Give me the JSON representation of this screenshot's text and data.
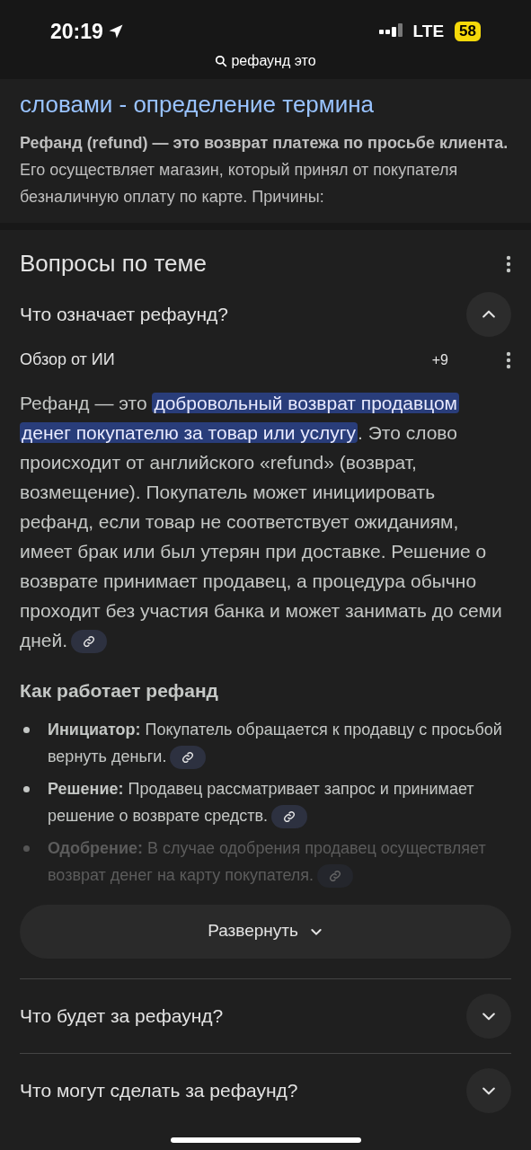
{
  "status_bar": {
    "time": "20:19",
    "network": "LTE",
    "battery": "58"
  },
  "address_bar": {
    "query": "рефаунд это"
  },
  "result": {
    "title": "словами - определение термина",
    "snippet": "**Рефанд (refund) — это возврат платежа по просьбе клиента.** Его осуществляет магазин, который принял от покупателя безналичную оплату по карте. Причины:"
  },
  "related": {
    "title": "Вопросы по теме",
    "questions": [
      {
        "question": "Что означает рефаунд?",
        "expanded": true,
        "answer": {
          "label": "Обзор от ИИ",
          "count": "+9",
          "text_before": "Рефанд — это ",
          "highlight": "добровольный возврат продавцом денег покупателю за товар или услугу",
          "text_after": ". Это слово происходит от английского «refund» (возврат, возмещение). Покупатель может инициировать рефанд, если товар не соответствует ожиданиям, имеет брак или был утерян при доставке. Решение о возврате принимает продавец, а процедура обычно проходит без участия банка и может занимать до семи дней.",
          "subheading": "Как работает рефанд",
          "bullets": [
            {
              "text": "**Инициатор:** Покупатель обращается к продавцу с просьбой вернуть деньги.",
              "faded": false
            },
            {
              "text": "**Решение:** Продавец рассматривает запрос и принимает решение о возврате средств.",
              "faded": false
            },
            {
              "text": "**Одобрение:** В случае одобрения продавец осуществляет возврат денег на карту покупателя.",
              "faded": true
            }
          ],
          "expand_button": "Развернуть"
        }
      },
      {
        "question": "Что будет за рефаунд?",
        "expanded": false
      },
      {
        "question": "Что могут сделать за рефаунд?",
        "expanded": false
      }
    ]
  }
}
